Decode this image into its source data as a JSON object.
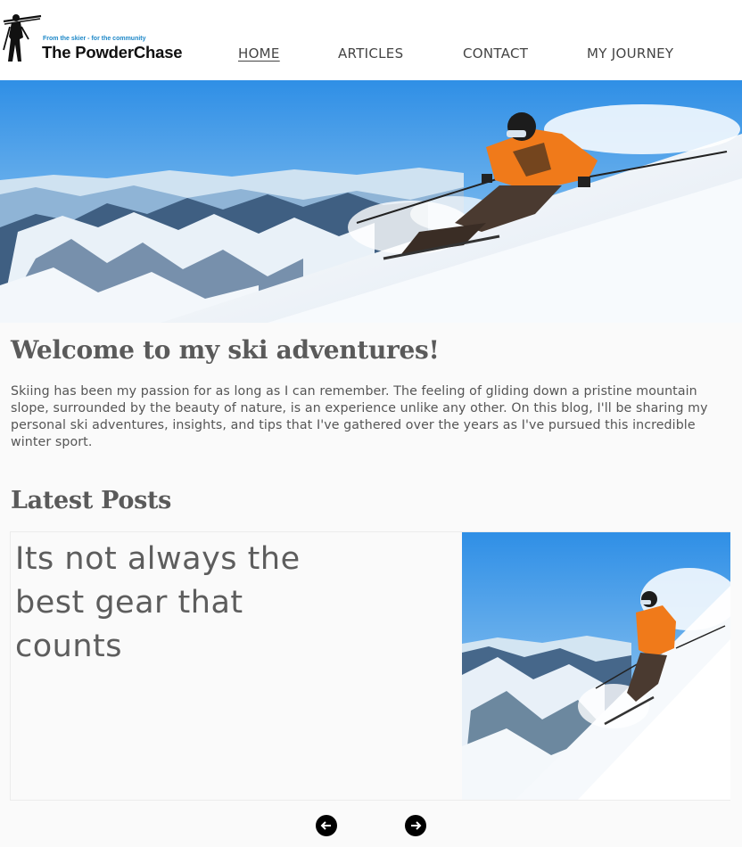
{
  "header": {
    "logo": {
      "tagline": "From the skier - for the community",
      "name": "The PowderChase"
    },
    "nav": {
      "home": "HOME",
      "articles": "ARTICLES",
      "contact": "CONTACT",
      "my_journey": "MY JOURNEY"
    },
    "active_nav": "HOME"
  },
  "hero": {
    "image": "skier-descending-snowy-slope"
  },
  "intro": {
    "title": "Welcome to my ski adventures!",
    "body": "Skiing has been my passion for as long as I can remember. The feeling of gliding down a pristine mountain slope, surrounded by the beauty of nature, is an experience unlike any other. On this blog, I'll be sharing my personal ski adventures, insights, and tips that I've gathered over the years as I've pursued this incredible winter sport."
  },
  "latest_posts": {
    "heading": "Latest Posts",
    "current_post": {
      "title": "Its not always the best gear that counts",
      "image": "skier-on-mountain-slope"
    },
    "controls": {
      "prev_icon": "arrow-left-icon",
      "next_icon": "arrow-right-icon"
    }
  },
  "colors": {
    "tagline_blue": "#1e88c8",
    "text_gray": "#555555",
    "sky_blue": "#3d97e6",
    "jacket_orange": "#f07a1a"
  }
}
